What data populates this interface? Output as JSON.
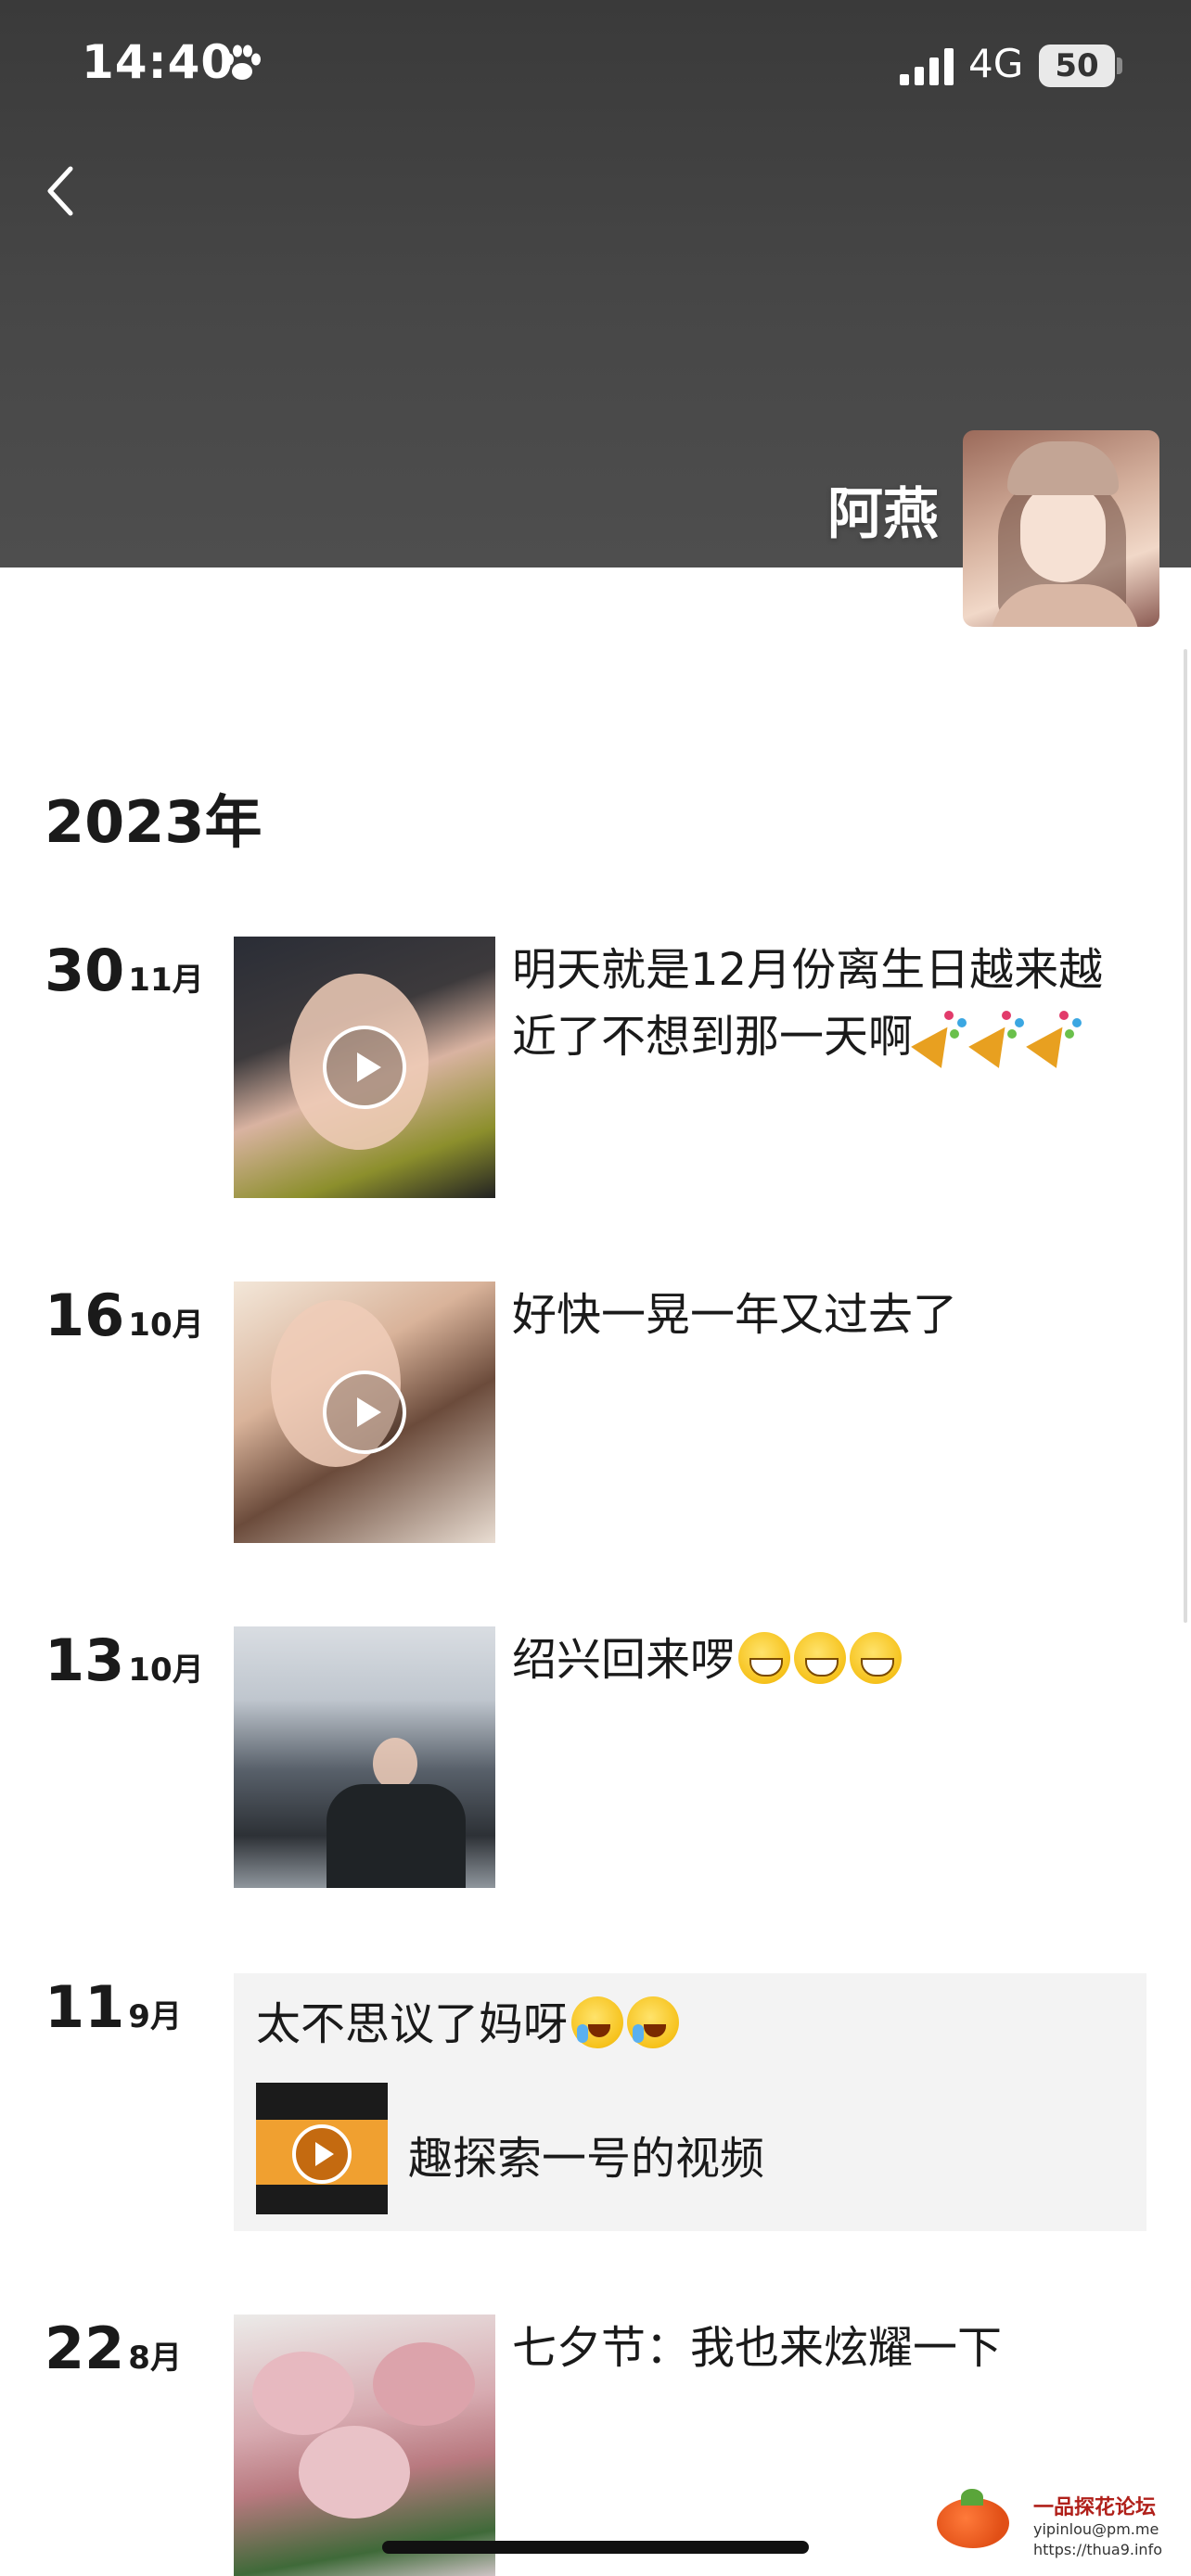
{
  "status_bar": {
    "time": "14:40",
    "network": "4G",
    "battery": "50",
    "icons": [
      "paw-icon",
      "signal-icon"
    ]
  },
  "header": {
    "back_icon": "chevron-left-icon",
    "profile_name": "阿燕",
    "avatar_icon": "avatar"
  },
  "timeline": {
    "year": "2023年",
    "entries": [
      {
        "day": "30",
        "month": "11月",
        "text": "明天就是12月份离生日越来越近了不想到那一天啊",
        "media": "video",
        "emoji": [
          "party-popper",
          "party-popper",
          "party-popper"
        ]
      },
      {
        "day": "16",
        "month": "10月",
        "text": "好快一晃一年又过去了",
        "media": "video"
      },
      {
        "day": "13",
        "month": "10月",
        "text": "绍兴回来啰",
        "media": "image",
        "emoji": [
          "grin",
          "grin",
          "grin"
        ]
      },
      {
        "day": "11",
        "month": "9月",
        "text": "太不思议了妈呀",
        "media": "shared-link",
        "emoji": [
          "rolling-laugh",
          "rolling-laugh"
        ],
        "link_label": "趣探索一号的视频"
      },
      {
        "day": "22",
        "month": "8月",
        "text": "七夕节：我也来炫耀一下",
        "media": "image"
      }
    ]
  },
  "watermark": {
    "title": "一品探花论坛",
    "email": "yipinlou@pm.me",
    "url": "https://thua9.info"
  },
  "colors": {
    "cover_bg": "#454545",
    "card_bg": "#f3f3f3",
    "text": "#1a1a1a"
  }
}
